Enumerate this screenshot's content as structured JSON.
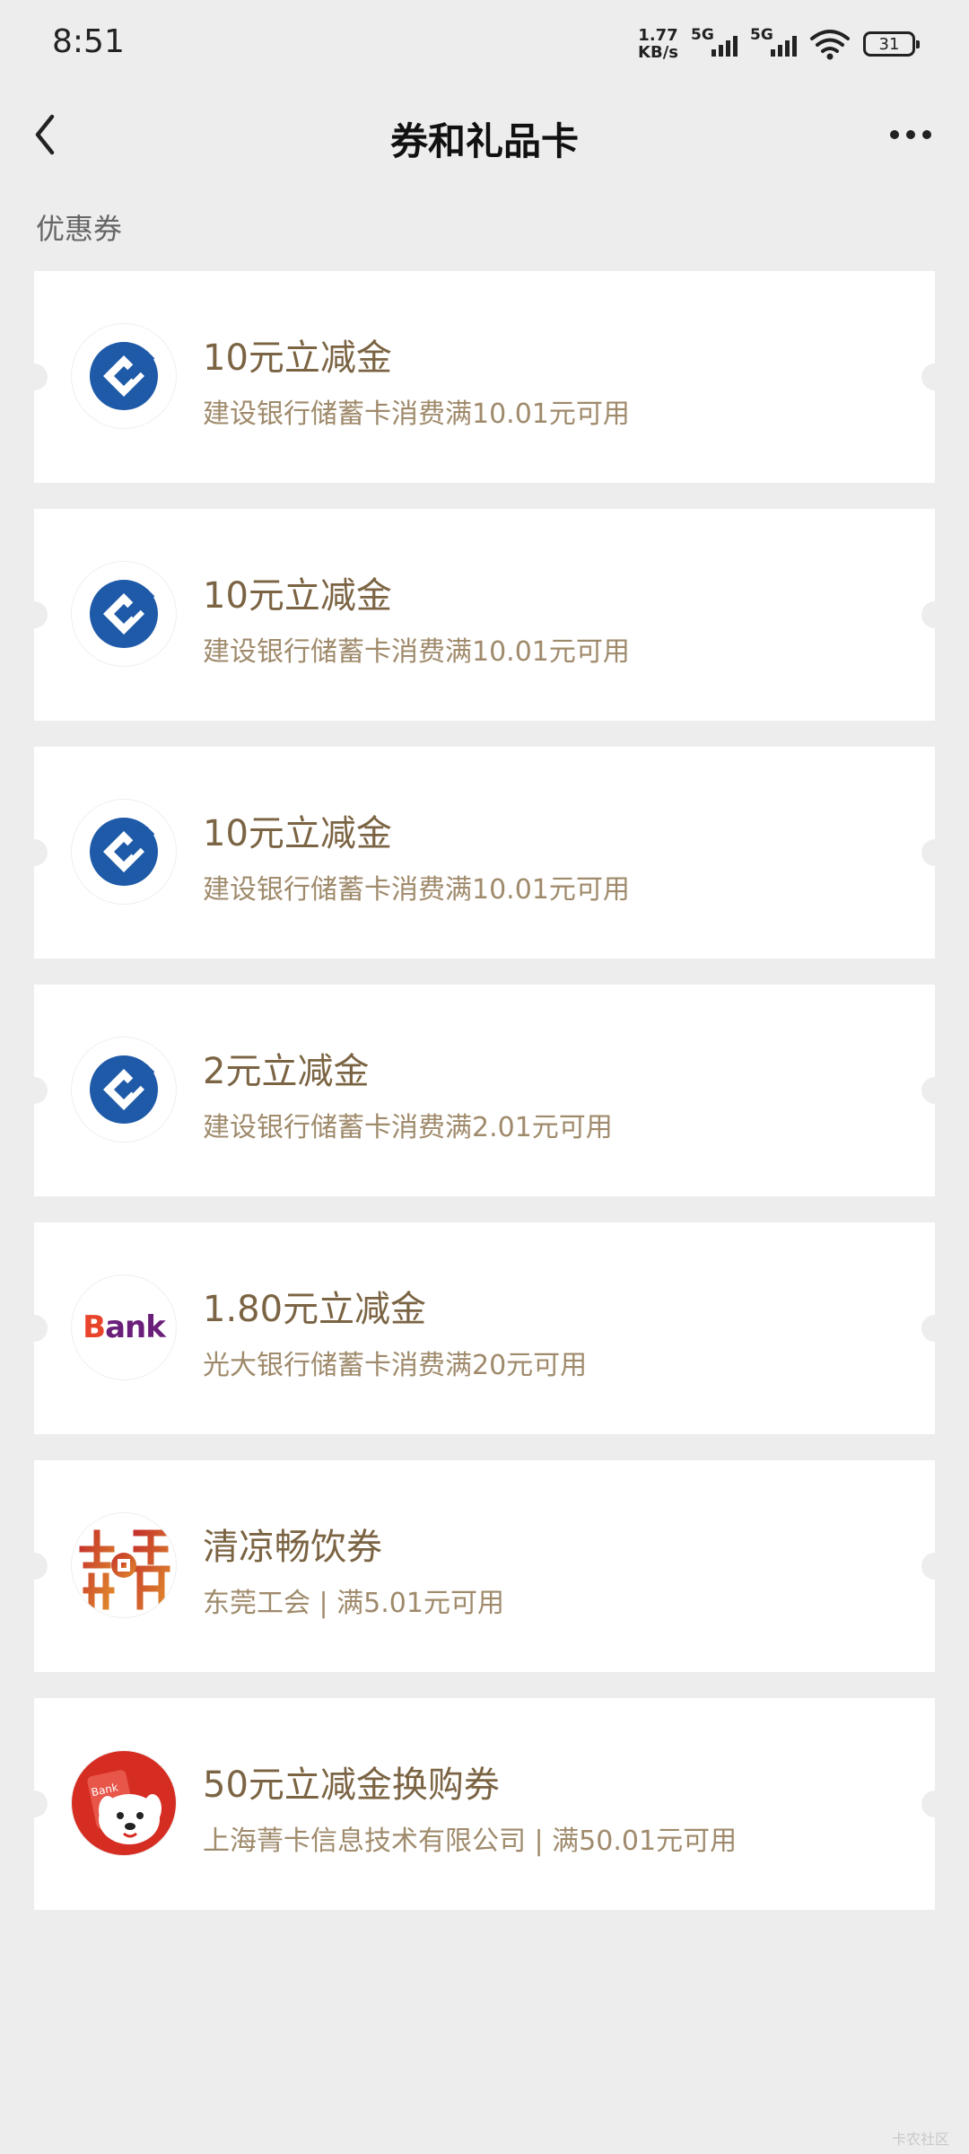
{
  "status_bar": {
    "time": "8:51",
    "net_speed_value": "1.77",
    "net_speed_unit": "KB/s",
    "signal_1_label": "5G",
    "signal_2_label": "5G",
    "battery": "31"
  },
  "nav": {
    "title": "券和礼品卡",
    "back_icon": "chevron-left-icon",
    "more_icon": "more-dots-icon"
  },
  "section": {
    "title": "优惠券"
  },
  "coupons": [
    {
      "logo": "ccb-logo",
      "title": "10元立减金",
      "desc": "建设银行储蓄卡消费满10.01元可用"
    },
    {
      "logo": "ccb-logo",
      "title": "10元立减金",
      "desc": "建设银行储蓄卡消费满10.01元可用"
    },
    {
      "logo": "ccb-logo",
      "title": "10元立减金",
      "desc": "建设银行储蓄卡消费满10.01元可用"
    },
    {
      "logo": "ccb-logo",
      "title": "2元立减金",
      "desc": "建设银行储蓄卡消费满2.01元可用"
    },
    {
      "logo": "ceb-bank-logo",
      "logo_text_b": "B",
      "logo_text_rest": "ank",
      "title": "1.80元立减金",
      "desc": "光大银行储蓄卡消费满20元可用"
    },
    {
      "logo": "union-seal-logo",
      "title": "清凉畅饮券",
      "desc": "东莞工会 | 满5.01元可用"
    },
    {
      "logo": "jd-dog-bank-logo",
      "logo_text": "Bank",
      "title": "50元立减金换购券",
      "desc": "上海菁卡信息技术有限公司 | 满50.01元可用"
    }
  ],
  "watermark": "卡农社区",
  "colors": {
    "background": "#ededed",
    "card": "#ffffff",
    "title_text": "#7b6443",
    "desc_text": "#9f8a6b",
    "ccb_blue": "#1e5aa8"
  }
}
